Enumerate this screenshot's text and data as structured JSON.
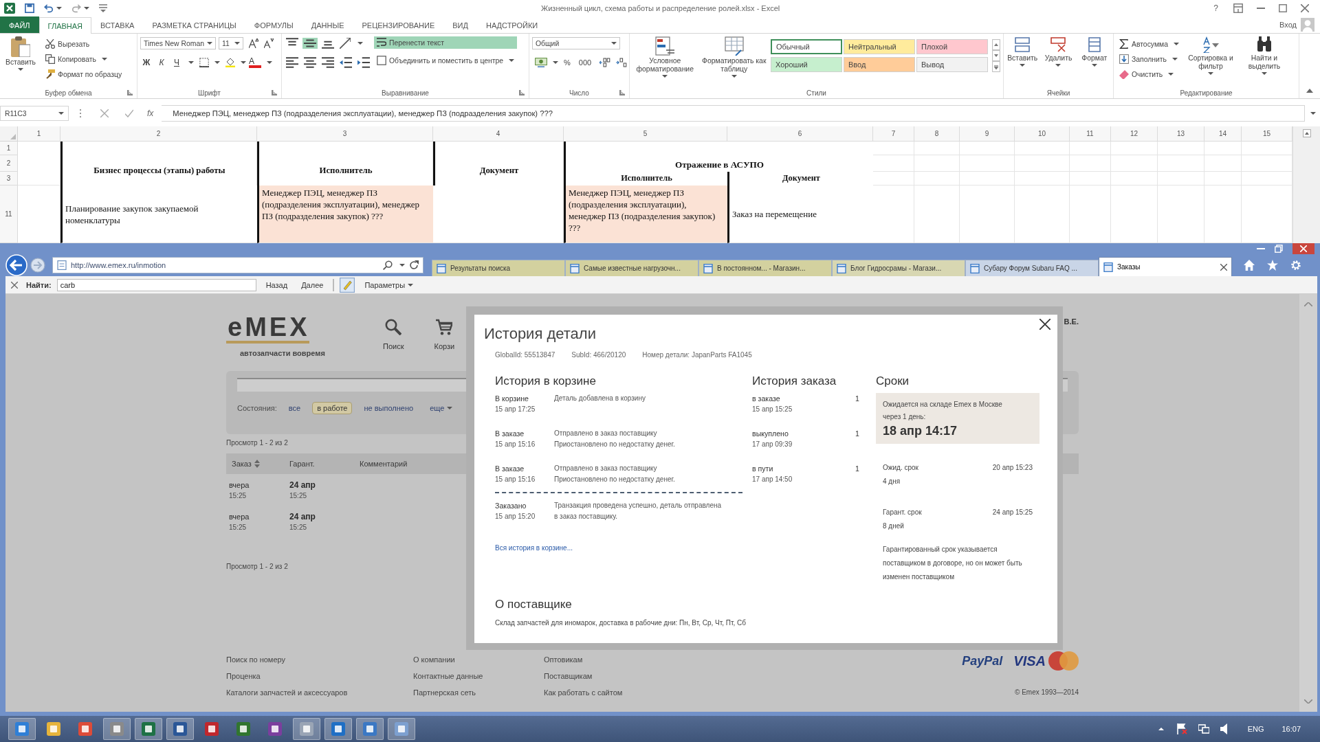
{
  "excel": {
    "title": "Жизненный цикл, схема работы и распределение ролей.xlsx - Excel",
    "help": "?",
    "tabs": [
      {
        "label": "ФАЙЛ",
        "kind": "file",
        "selected": false
      },
      {
        "label": "ГЛАВНАЯ",
        "kind": "tab",
        "selected": true
      },
      {
        "label": "ВСТАВКА",
        "kind": "tab",
        "selected": false
      },
      {
        "label": "РАЗМЕТКА СТРАНИЦЫ",
        "kind": "tab",
        "selected": false
      },
      {
        "label": "ФОРМУЛЫ",
        "kind": "tab",
        "selected": false
      },
      {
        "label": "ДАННЫЕ",
        "kind": "tab",
        "selected": false
      },
      {
        "label": "РЕЦЕНЗИРОВАНИЕ",
        "kind": "tab",
        "selected": false
      },
      {
        "label": "ВИД",
        "kind": "tab",
        "selected": false
      },
      {
        "label": "НАДСТРОЙКИ",
        "kind": "tab",
        "selected": false
      }
    ],
    "sign_in": "Вход",
    "ribbon": {
      "clipboard": {
        "label": "Буфер обмена",
        "paste": "Вставить",
        "cut": "Вырезать",
        "copy": "Копировать",
        "format_painter": "Формат по образцу"
      },
      "font": {
        "label": "Шрифт",
        "family": "Times New Roman",
        "size": "11",
        "bold": "Ж",
        "italic": "К",
        "underline": "Ч",
        "font_color": "А"
      },
      "alignment": {
        "label": "Выравнивание",
        "vertical": [
          {
            "selected": false
          },
          {
            "selected": true
          },
          {
            "selected": false
          }
        ],
        "wrap_text": {
          "label": "Перенести текст",
          "on": true
        },
        "merge": "Объединить и поместить в центре"
      },
      "number": {
        "label": "Число",
        "format": "Общий",
        "percent": "%",
        "thousands": "000"
      },
      "styles": {
        "label": "Стили",
        "conditional": "Условное форматирование",
        "format_table": "Форматировать как таблицу",
        "gallery": [
          {
            "label": "Обычный",
            "color": "#ffffff",
            "selected": true
          },
          {
            "label": "Нейтральный",
            "color": "#ffeb9c",
            "selected": false
          },
          {
            "label": "Плохой",
            "color": "#ffc7ce",
            "selected": false
          },
          {
            "label": "Хороший",
            "color": "#c6efce",
            "selected": false
          },
          {
            "label": "Ввод",
            "color": "#ffcc99",
            "selected": false
          },
          {
            "label": "Вывод",
            "color": "#f2f2f2",
            "selected": false
          }
        ]
      },
      "cells": {
        "label": "Ячейки",
        "buttons": [
          "Вставить",
          "Удалить",
          "Формат"
        ]
      },
      "editing": {
        "label": "Редактирование",
        "autosum": "Автосумма",
        "fill": "Заполнить",
        "clear": "Очистить",
        "sort": "Сортировка и фильтр",
        "find": "Найти и выделить"
      }
    },
    "name_box": "R11C3",
    "function_label": "fx",
    "formula": "Менеджер ПЭЦ, менеджер ПЗ (подразделения эксплуатации), менеджер ПЗ (подразделения закупок) ???",
    "sheet": {
      "columns": [
        "1",
        "2",
        "3",
        "4",
        "5",
        "6",
        "7",
        "8",
        "9",
        "10",
        "11",
        "12",
        "13",
        "14",
        "15"
      ],
      "rows": [
        "1",
        "2",
        "3",
        "11"
      ],
      "headers": [
        "Бизнес процессы (этапы) работы",
        "Исполнитель",
        "Документ"
      ],
      "group_header": "Отражение в АСУПО",
      "sub_headers": [
        "Исполнитель",
        "Документ"
      ],
      "data_row": {
        "process": {
          "text": "Планирование закупок закупаемой номенклатуры",
          "highlighted": false
        },
        "performer": {
          "text": "Менеджер ПЭЦ, менеджер ПЗ (подразделения эксплуатации), менеджер ПЗ (подразделения закупок) ???",
          "highlighted": true
        },
        "asupo_performer": {
          "text": "Менеджер ПЭЦ, менеджер ПЗ (подразделения эксплуатации), менеджер ПЗ (подразделения закупок) ???",
          "highlighted": true
        },
        "asupo_document": {
          "text": "Заказ на перемещение",
          "highlighted": false
        }
      }
    }
  },
  "browser": {
    "address": "http://www.emex.ru/inmotion",
    "tabs": [
      {
        "label": "Результаты поиска",
        "color": "#d3d19f",
        "selected": false
      },
      {
        "label": "Самые известные нагрузочн...",
        "color": "#d3d19f",
        "selected": false
      },
      {
        "label": "В постоянном... - Магазин...",
        "color": "#d3d19f",
        "selected": false
      },
      {
        "label": "Блог Гидросрамы - Магази...",
        "color": "#d8d7b2",
        "selected": false
      },
      {
        "label": "Субару Форум Subaru FAQ ...",
        "color": "#c9d5e7",
        "selected": false
      },
      {
        "label": "Заказы",
        "color": "#ffffff",
        "selected": true
      }
    ],
    "find_bar": {
      "label": "Найти:",
      "value": "carb",
      "previous": "Назад",
      "next": "Далее",
      "options": "Параметры"
    }
  },
  "page": {
    "logo": "eMEX",
    "tagline": "автозапчасти вовремя",
    "nav": [
      {
        "label": "Поиск",
        "kind": "search"
      },
      {
        "label": "Корзи",
        "kind": "cart"
      }
    ],
    "user": "В.Е.",
    "filter": {
      "label": "Состояния:",
      "options": [
        {
          "label": "все",
          "selected": false
        },
        {
          "label": "в работе",
          "selected": true
        },
        {
          "label": "не выполнено",
          "selected": false
        }
      ],
      "more": "еще"
    },
    "summary_top": "Просмотр 1 - 2 из 2",
    "table": {
      "columns": [
        "Заказ",
        "Гарант.",
        "Комментарий"
      ],
      "rows": [
        {
          "order": "вчера",
          "order_time": "15:25",
          "guarantee": "24 апр",
          "guarantee_time": "15:25"
        },
        {
          "order": "вчера",
          "order_time": "15:25",
          "guarantee": "24 апр",
          "guarantee_time": "15:25"
        }
      ]
    },
    "summary_bottom": "Просмотр 1 - 2 из 2",
    "footer": {
      "links": [
        [
          "Поиск по номеру",
          "Проценка",
          "Каталоги запчастей и аксессуаров"
        ],
        [
          "О компании",
          "Контактные данные",
          "Партнерская сеть"
        ],
        [
          "Оптовикам",
          "Поставщикам",
          "Как работать с сайтом"
        ]
      ],
      "payments": [
        "PayPal",
        "VISA"
      ],
      "copyright": "© Emex 1993—2014"
    }
  },
  "dialog": {
    "title": "История детали",
    "info": [
      "GlobalId: 55513847",
      "SubId: 466/20120",
      "Номер детали: JapanParts FA1045"
    ],
    "cart_history": {
      "title": "История в корзине",
      "entries": [
        {
          "status": "В корзине",
          "time": "15 апр 17:25",
          "lines": [
            "Деталь добавлена в корзину"
          ],
          "divider_before": false
        },
        {
          "status": "В заказе",
          "time": "15 апр 15:16",
          "lines": [
            "Отправлено в заказ поставщику",
            "Приостановлено по недостатку денег."
          ],
          "divider_before": false
        },
        {
          "status": "В заказе",
          "time": "15 апр 15:16",
          "lines": [
            "Отправлено в заказ поставщику",
            "Приостановлено по недостатку денег."
          ],
          "divider_before": false
        },
        {
          "status": "Заказано",
          "time": "15 апр 15:20",
          "lines": [
            "Транзакция проведена успешно, деталь отправлена",
            "в заказ поставщику."
          ],
          "divider_before": true
        }
      ],
      "link": "Вся история в корзине..."
    },
    "order_history": {
      "title": "История заказа",
      "entries": [
        {
          "status": "в заказе",
          "count": "1",
          "time": "15 апр 15:25"
        },
        {
          "status": "выкуплено",
          "count": "1",
          "time": "17 апр 09:39"
        },
        {
          "status": "в пути",
          "count": "1",
          "time": "17 апр 14:50"
        }
      ]
    },
    "timing": {
      "title": "Сроки",
      "expected": {
        "text": "Ожидается на складе Emex в Москве",
        "sub": "через 1 день:",
        "date": "18 апр 14:17"
      },
      "rows": [
        {
          "label": "Ожид. срок",
          "date": "20 апр 15:23",
          "duration": "4 дня"
        },
        {
          "label": "Гарант. срок",
          "date": "24 апр 15:25",
          "duration": "8 дней"
        }
      ],
      "note": "Гарантированный срок указывается поставщиком в договоре, но он может быть изменен поставщиком"
    },
    "supplier": {
      "title": "О поставщике",
      "text": "Склад запчастей для иномарок, доставка в рабочие дни: Пн, Вт, Ср, Чт, Пт, Сб"
    }
  },
  "taskbar": {
    "apps": [
      {
        "color": "#2f7fd6",
        "running": true
      },
      {
        "color": "#e6b43c",
        "running": false
      },
      {
        "color": "#dd4b39",
        "running": false
      },
      {
        "color": "#8a8a8a",
        "running": true
      },
      {
        "color": "#1e7145",
        "running": true
      },
      {
        "color": "#2b5797",
        "running": true
      },
      {
        "color": "#c0272d",
        "running": false
      },
      {
        "color": "#31752f",
        "running": false
      },
      {
        "color": "#7b3f9e",
        "running": false
      },
      {
        "color": "#9aa5b5",
        "running": true
      },
      {
        "color": "#1f6fc5",
        "running": true
      },
      {
        "color": "#3b78c4",
        "running": true
      },
      {
        "color": "#7da0d0",
        "running": true
      }
    ],
    "language": "ENG",
    "time": "16:07"
  }
}
